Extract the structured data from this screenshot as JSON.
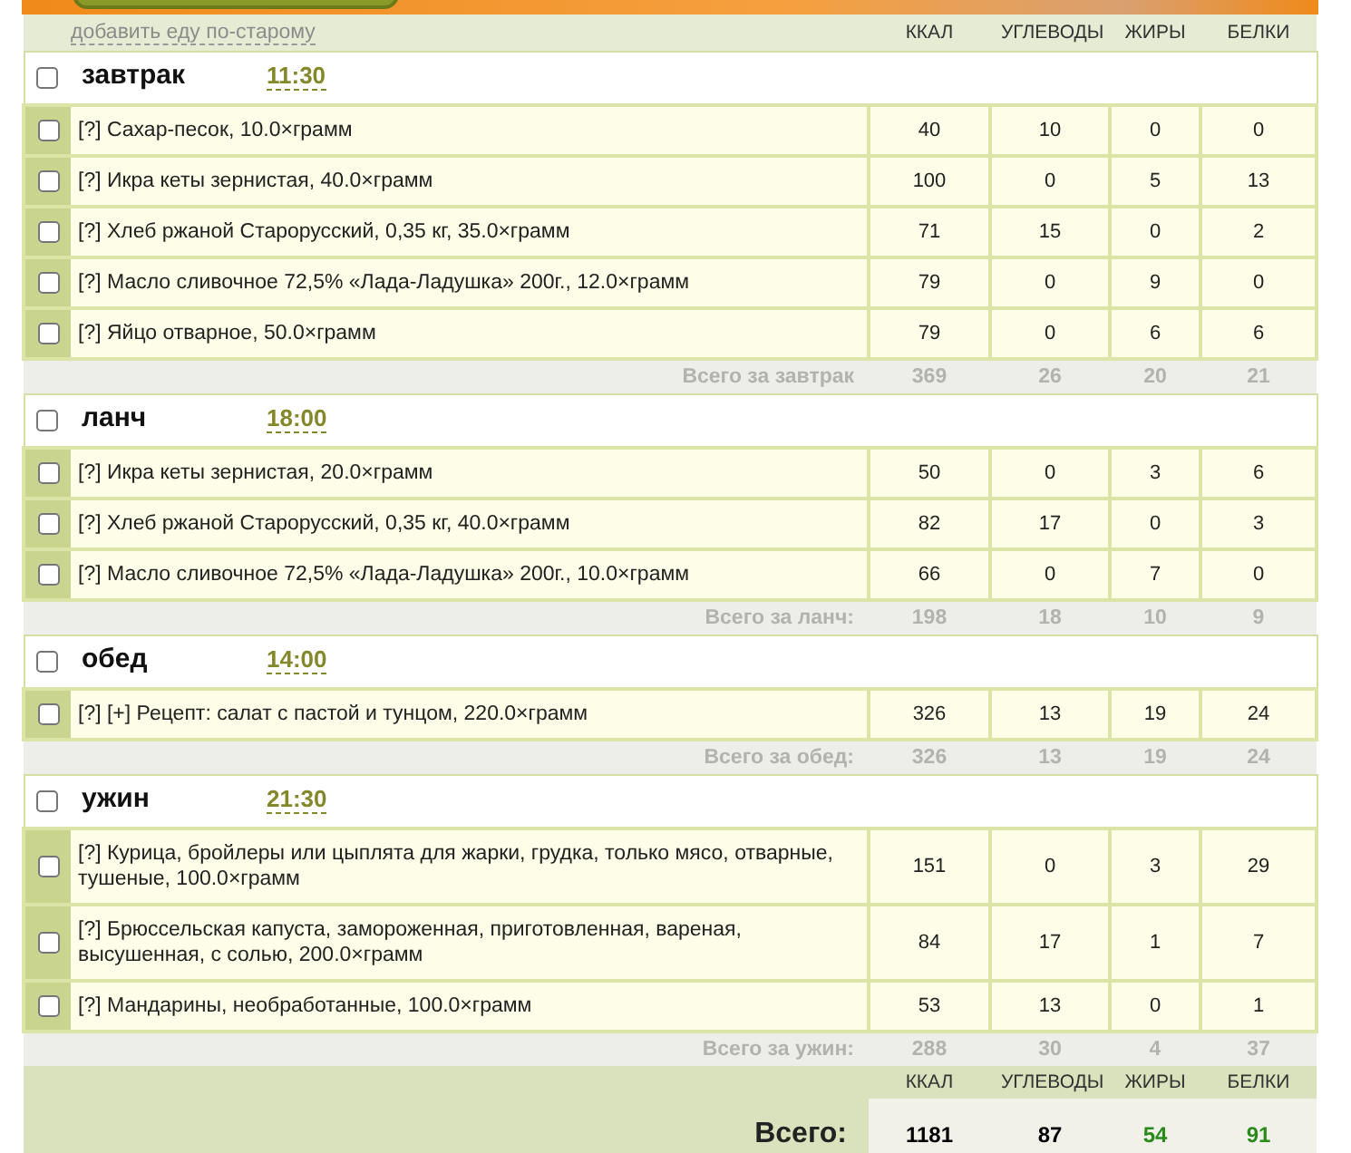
{
  "header": {
    "add_link": "добавить еду по-старому"
  },
  "columns": [
    "ККАЛ",
    "УГЛЕВОДЫ",
    "ЖИРЫ",
    "БЕЛКИ"
  ],
  "meals": [
    {
      "name": "завтрак",
      "time": "11:30",
      "checked": false,
      "items": [
        {
          "name": "[?] Сахар-песок, 10.0×грамм",
          "checked": false,
          "values": [
            "40",
            "10",
            "0",
            "0"
          ]
        },
        {
          "name": "[?] Икра кеты зернистая, 40.0×грамм",
          "checked": false,
          "values": [
            "100",
            "0",
            "5",
            "13"
          ]
        },
        {
          "name": "[?] Хлеб ржаной Старорусский, 0,35 кг, 35.0×грамм",
          "checked": false,
          "values": [
            "71",
            "15",
            "0",
            "2"
          ]
        },
        {
          "name": "[?] Масло сливочное 72,5% «Лада-Ладушка» 200г., 12.0×грамм",
          "checked": false,
          "values": [
            "79",
            "0",
            "9",
            "0"
          ]
        },
        {
          "name": "[?] Яйцо отварное, 50.0×грамм",
          "checked": false,
          "values": [
            "79",
            "0",
            "6",
            "6"
          ]
        }
      ],
      "summary_label": "Всего за завтрак",
      "summary": [
        "369",
        "26",
        "20",
        "21"
      ]
    },
    {
      "name": "ланч",
      "time": "18:00",
      "checked": false,
      "items": [
        {
          "name": "[?] Икра кеты зернистая, 20.0×грамм",
          "checked": false,
          "values": [
            "50",
            "0",
            "3",
            "6"
          ]
        },
        {
          "name": "[?] Хлеб ржаной Старорусский, 0,35 кг, 40.0×грамм",
          "checked": false,
          "values": [
            "82",
            "17",
            "0",
            "3"
          ]
        },
        {
          "name": "[?] Масло сливочное 72,5% «Лада-Ладушка» 200г., 10.0×грамм",
          "checked": false,
          "values": [
            "66",
            "0",
            "7",
            "0"
          ]
        }
      ],
      "summary_label": "Всего за ланч:",
      "summary": [
        "198",
        "18",
        "10",
        "9"
      ]
    },
    {
      "name": "обед",
      "time": "14:00",
      "checked": false,
      "items": [
        {
          "name": "[?] [+] Рецепт: салат с пастой и тунцом, 220.0×грамм",
          "checked": false,
          "values": [
            "326",
            "13",
            "19",
            "24"
          ]
        }
      ],
      "summary_label": "Всего за обед:",
      "summary": [
        "326",
        "13",
        "19",
        "24"
      ]
    },
    {
      "name": "ужин",
      "time": "21:30",
      "checked": false,
      "items": [
        {
          "name": "[?] Курица, бройлеры или цыплята для жарки, грудка, только мясо, отварные, тушеные, 100.0×грамм",
          "checked": false,
          "values": [
            "151",
            "0",
            "3",
            "29"
          ]
        },
        {
          "name": "[?] Брюссельская капуста, замороженная, приготовленная, вареная, высушенная, с солью, 200.0×грамм",
          "checked": false,
          "values": [
            "84",
            "17",
            "1",
            "7"
          ]
        },
        {
          "name": "[?] Мандарины, необработанные, 100.0×грамм",
          "checked": false,
          "values": [
            "53",
            "13",
            "0",
            "1"
          ]
        }
      ],
      "summary_label": "Всего за ужин:",
      "summary": [
        "288",
        "30",
        "4",
        "37"
      ]
    }
  ],
  "footer": {
    "columns": [
      "ККАЛ",
      "УГЛЕВОДЫ",
      "ЖИРЫ",
      "БЕЛКИ"
    ],
    "label": "Всего:",
    "totals": [
      {
        "value": "1181",
        "color": "#000000"
      },
      {
        "value": "87",
        "color": "#000000"
      },
      {
        "value": "54",
        "color": "#2a8a1a"
      },
      {
        "value": "91",
        "color": "#2a8a1a"
      }
    ]
  }
}
